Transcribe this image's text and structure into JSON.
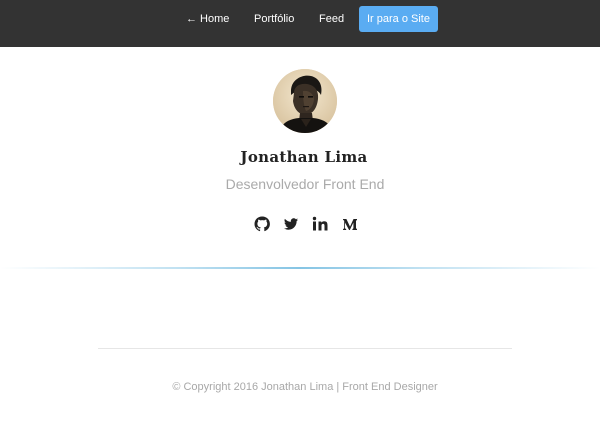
{
  "nav": {
    "home_label": "← Home",
    "portfolio_label": "Portfólio",
    "feed_label": "Feed",
    "cta_label": "Ir para o Site"
  },
  "profile": {
    "name": "Jonathan Lima",
    "role": "Desenvolvedor Front End"
  },
  "social": {
    "icons": [
      "github-icon",
      "twitter-icon",
      "linkedin-icon",
      "medium-icon"
    ]
  },
  "footer": {
    "text": "© Copyright 2016 Jonathan Lima | Front End Designer"
  },
  "colors": {
    "topbar": "#333333",
    "accent": "#5aacf2",
    "role_text": "#aaaaaa",
    "footer_text": "#a8a8a8"
  }
}
